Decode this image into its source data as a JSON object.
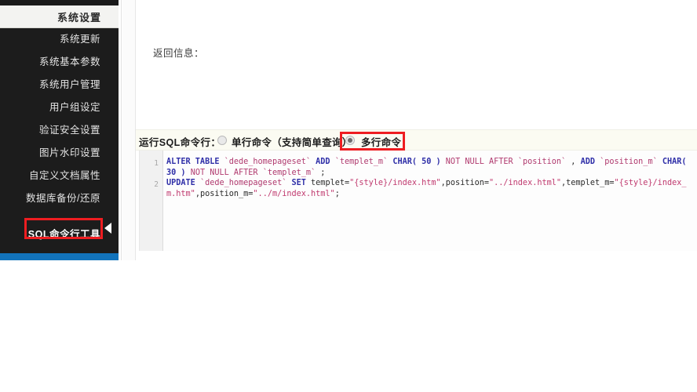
{
  "sidebar": {
    "header_title": "系统设置",
    "items": [
      {
        "label": "系统更新",
        "active": false
      },
      {
        "label": "系统基本参数",
        "active": false
      },
      {
        "label": "系统用户管理",
        "active": false
      },
      {
        "label": "用户组设定",
        "active": false
      },
      {
        "label": "验证安全设置",
        "active": false
      },
      {
        "label": "图片水印设置",
        "active": false
      },
      {
        "label": "自定义文档属性",
        "active": false
      },
      {
        "label": "数据库备份/还原",
        "active": false
      },
      {
        "label": "SQL命令行工具",
        "active": true
      }
    ],
    "highlight_color": "#ee1d21",
    "footer_color": "#1273bb",
    "background_color": "#1c1c1c"
  },
  "content": {
    "return_info_label": "返回信息：",
    "sql_mode": {
      "label": "运行SQL命令行：",
      "options": [
        {
          "label": "单行命令（支持简单查询）",
          "checked": false
        },
        {
          "label": "多行命令",
          "checked": true
        }
      ],
      "row_background": "#fbfbf2",
      "highlight_color": "#ee1d21"
    },
    "editor": {
      "line_numbers": [
        "1",
        "2"
      ],
      "lines": [
        {
          "number": "1",
          "text": "ALTER TABLE `dede_homepageset` ADD `templet_m` CHAR( 50 ) NOT NULL AFTER `position` , ADD `position_m` CHAR( 30 ) NOT NULL AFTER `templet_m` ;",
          "tokens": [
            {
              "t": "ALTER TABLE",
              "c": "kw"
            },
            {
              "t": " ",
              "c": "pl"
            },
            {
              "t": "`dede_homepageset`",
              "c": "id"
            },
            {
              "t": " ",
              "c": "pl"
            },
            {
              "t": "ADD",
              "c": "kw"
            },
            {
              "t": " ",
              "c": "pl"
            },
            {
              "t": "`templet_m`",
              "c": "id"
            },
            {
              "t": " ",
              "c": "pl"
            },
            {
              "t": "CHAR( 50 )",
              "c": "kw"
            },
            {
              "t": " ",
              "c": "pl"
            },
            {
              "t": "NOT NULL AFTER",
              "c": "id"
            },
            {
              "t": " ",
              "c": "pl"
            },
            {
              "t": "`position`",
              "c": "id"
            },
            {
              "t": " , ",
              "c": "pl"
            },
            {
              "t": "ADD",
              "c": "kw"
            },
            {
              "t": " ",
              "c": "pl"
            },
            {
              "t": "`position_m`",
              "c": "id"
            },
            {
              "t": " ",
              "c": "pl"
            },
            {
              "t": "CHAR( 30 )",
              "c": "kw"
            },
            {
              "t": " ",
              "c": "pl"
            },
            {
              "t": "NOT NULL AFTER",
              "c": "id"
            },
            {
              "t": " ",
              "c": "pl"
            },
            {
              "t": "`templet_m`",
              "c": "id"
            },
            {
              "t": " ;",
              "c": "pl"
            }
          ]
        },
        {
          "number": "2",
          "text": "UPDATE `dede_homepageset` SET templet=\"{style}/index.htm\",position=\"../index.html\",templet_m=\"{style}/index_m.htm\",position_m=\"../m/index.html\";",
          "tokens": [
            {
              "t": "UPDATE",
              "c": "kw"
            },
            {
              "t": " ",
              "c": "pl"
            },
            {
              "t": "`dede_homepageset`",
              "c": "id"
            },
            {
              "t": " ",
              "c": "pl"
            },
            {
              "t": "SET",
              "c": "kw"
            },
            {
              "t": " templet=",
              "c": "pl"
            },
            {
              "t": "\"{style}/index.htm\"",
              "c": "str"
            },
            {
              "t": ",position=",
              "c": "pl"
            },
            {
              "t": "\"../index.html\"",
              "c": "str"
            },
            {
              "t": ",templet_m=",
              "c": "pl"
            },
            {
              "t": "\"{style}/index_m.htm\"",
              "c": "str"
            },
            {
              "t": ",position_m=",
              "c": "pl"
            },
            {
              "t": "\"../m/index.html\"",
              "c": "str"
            },
            {
              "t": ";",
              "c": "pl"
            }
          ]
        }
      ]
    }
  }
}
